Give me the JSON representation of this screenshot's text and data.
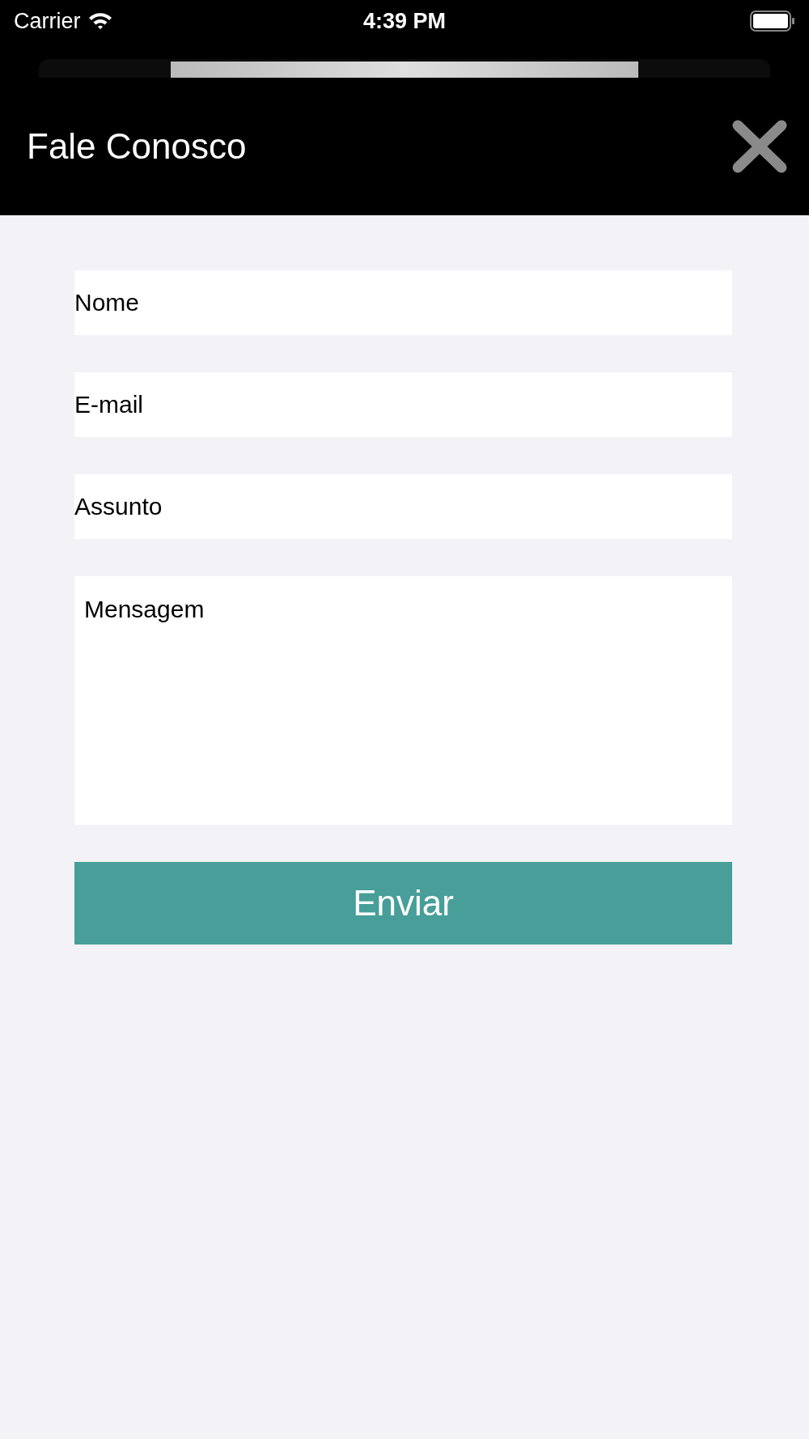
{
  "status_bar": {
    "carrier": "Carrier",
    "time": "4:39 PM"
  },
  "header": {
    "title": "Fale Conosco"
  },
  "form": {
    "fields": [
      {
        "kind": "input",
        "placeholder": "Nome"
      },
      {
        "kind": "input",
        "placeholder": "E-mail"
      },
      {
        "kind": "input",
        "placeholder": "Assunto"
      },
      {
        "kind": "textarea",
        "placeholder": "Mensagem"
      }
    ],
    "submit": "Enviar"
  }
}
